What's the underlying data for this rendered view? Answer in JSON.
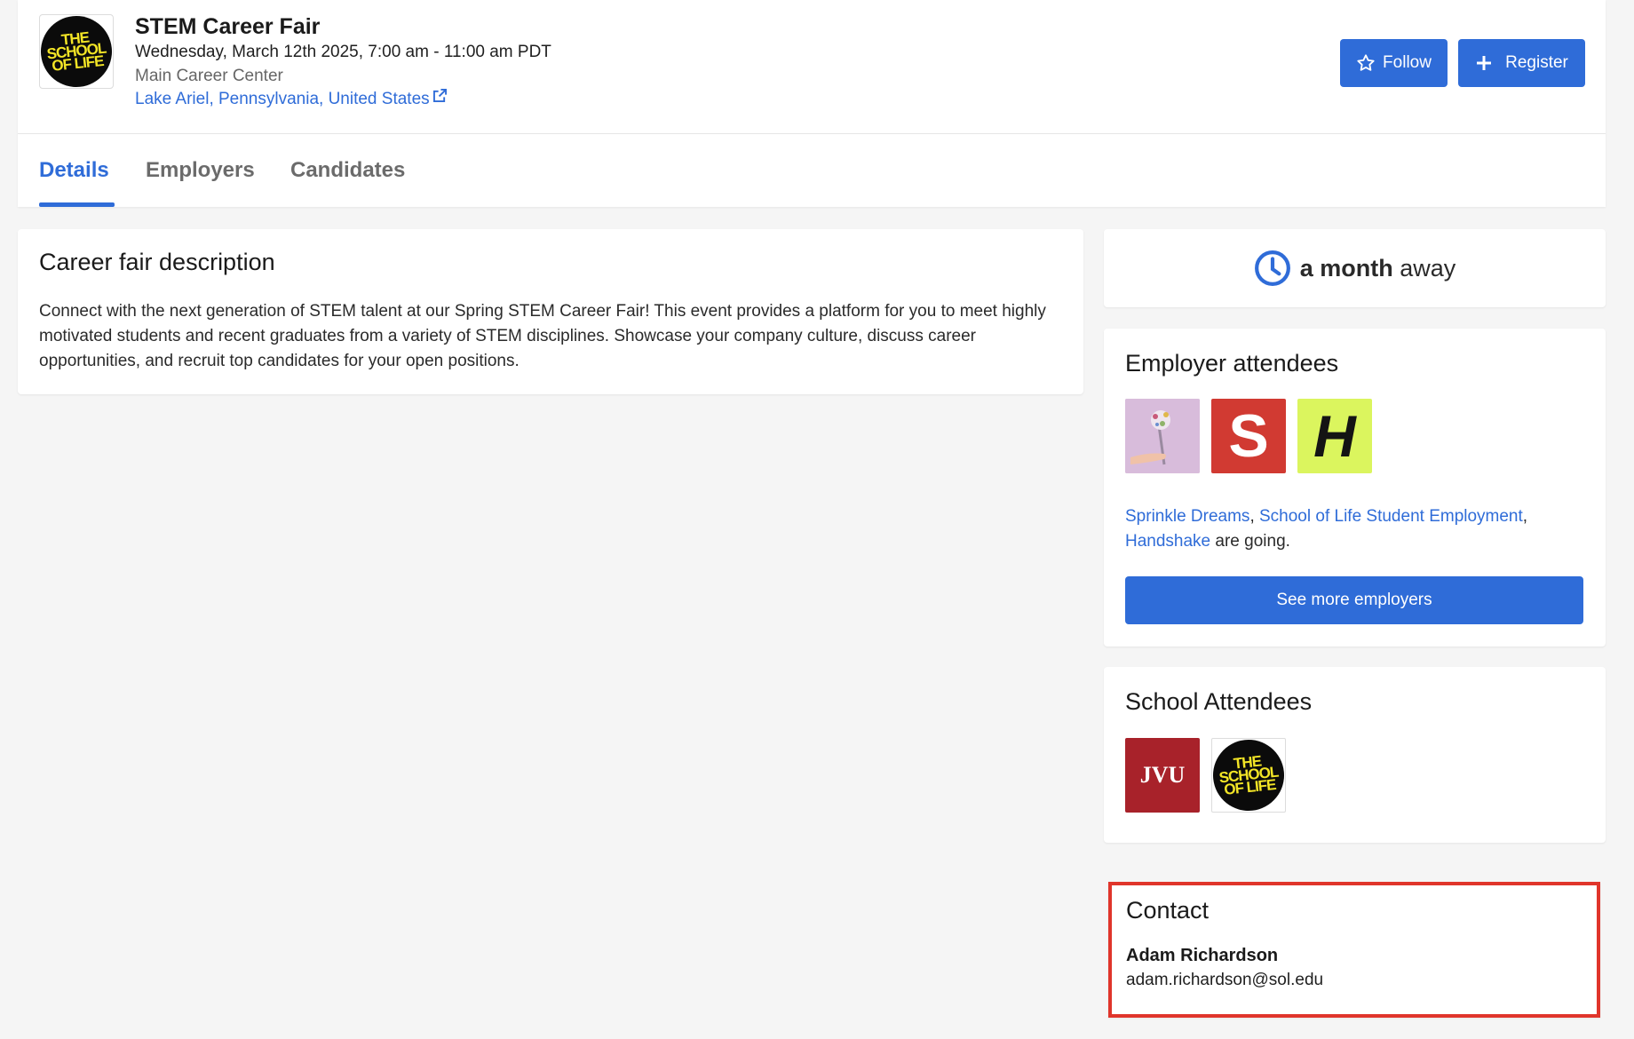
{
  "event": {
    "title": "STEM Career Fair",
    "date": "Wednesday, March 12th 2025, 7:00 am - 11:00 am PDT",
    "venue": "Main Career Center",
    "location": "Lake Ariel, Pennsylvania, United States",
    "logo_text": [
      "THE",
      "SCHOOL",
      "OF LIFE"
    ]
  },
  "actions": {
    "follow_label": "Follow",
    "register_label": "Register"
  },
  "tabs": [
    {
      "label": "Details",
      "active": true
    },
    {
      "label": "Employers",
      "active": false
    },
    {
      "label": "Candidates",
      "active": false
    }
  ],
  "description": {
    "title": "Career fair description",
    "body": "Connect with the next generation of STEM talent at our Spring STEM Career Fair! This event provides a platform for you to meet highly motivated students and recent graduates from a variety of STEM disciplines. Showcase your company culture, discuss career opportunities, and recruit top candidates for your open positions."
  },
  "countdown": {
    "strong": "a month",
    "rest": "away"
  },
  "employer_attendees": {
    "title": "Employer attendees",
    "logos": [
      {
        "name": "Sprinkle Dreams",
        "glyph": ""
      },
      {
        "name": "School of Life Student Employment",
        "glyph": "S"
      },
      {
        "name": "Handshake",
        "glyph": "H"
      }
    ],
    "links": [
      "Sprinkle Dreams",
      "School of Life Student Employment",
      "Handshake"
    ],
    "suffix": "are going.",
    "button_label": "See more employers"
  },
  "school_attendees": {
    "title": "School Attendees",
    "logos": [
      {
        "name": "JVU",
        "glyph": "JVU"
      },
      {
        "name": "The School of Life",
        "glyph": [
          "THE",
          "SCHOOL",
          "OF LIFE"
        ]
      }
    ]
  },
  "contact": {
    "title": "Contact",
    "name": "Adam Richardson",
    "email": "adam.richardson@sol.edu"
  },
  "colors": {
    "accent": "#2f6cd8",
    "highlight_outline": "#e0352b",
    "background": "#f5f5f5"
  }
}
